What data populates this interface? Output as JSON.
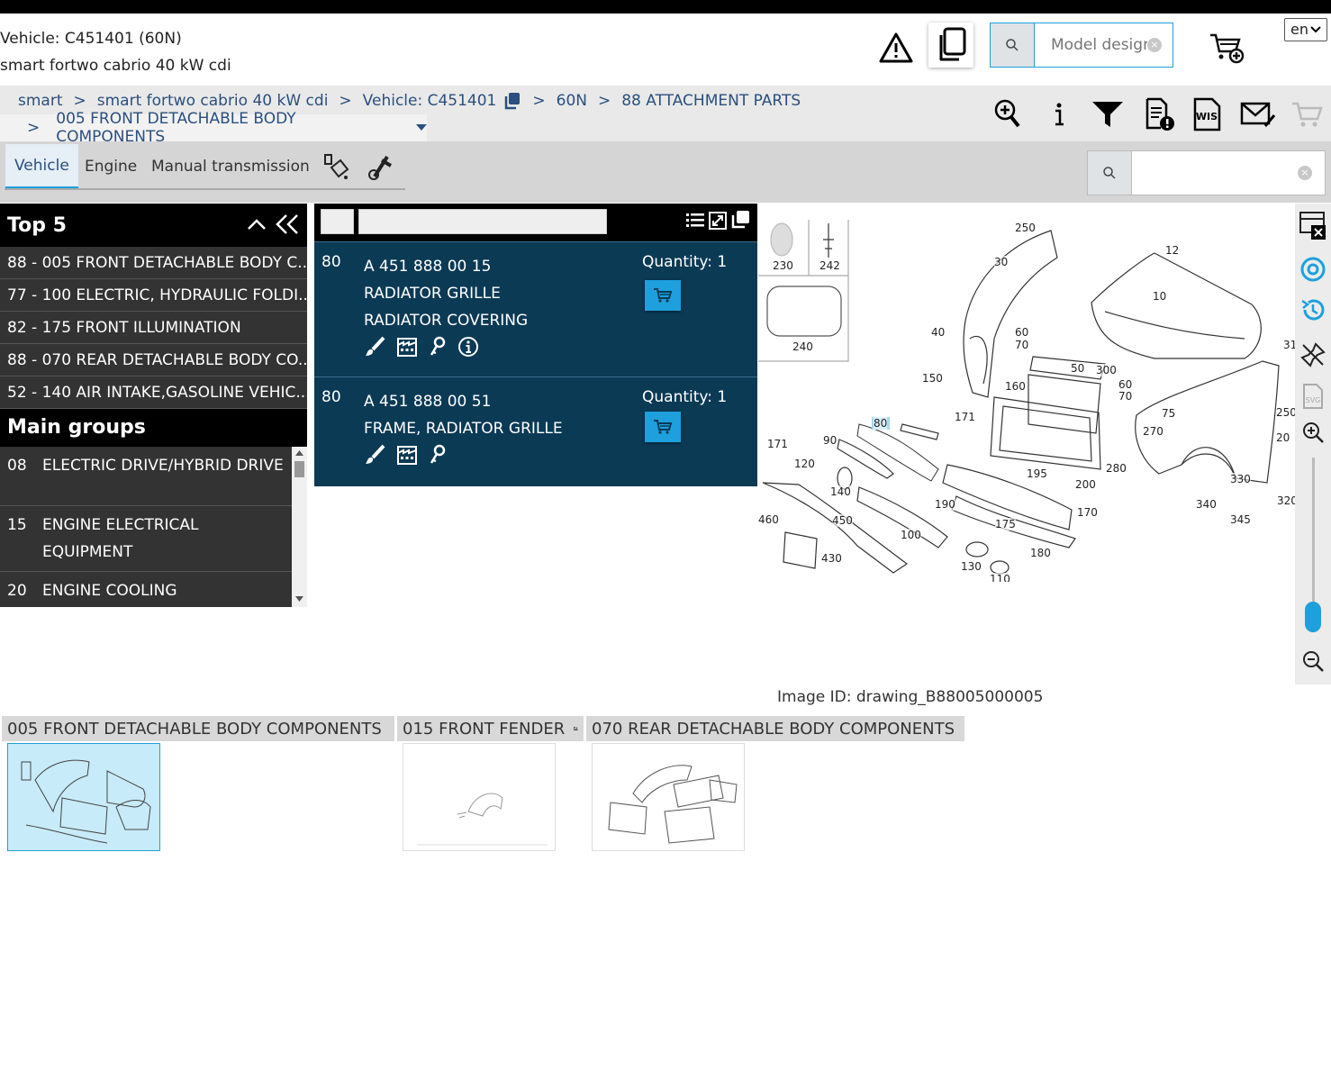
{
  "vehicle": {
    "line1": "Vehicle: C451401 (60N)",
    "line2": "smart fortwo cabrio 40 kW cdi"
  },
  "header_search": {
    "placeholder": "Model design"
  },
  "language": "en",
  "breadcrumb": {
    "items": [
      "smart",
      "smart fortwo cabrio 40 kW cdi",
      "Vehicle: C451401",
      "60N",
      "88 ATTACHMENT PARTS"
    ],
    "sep": ">",
    "current": "005 FRONT DETACHABLE BODY COMPONENTS"
  },
  "tabs": [
    "Vehicle",
    "Engine",
    "Manual transmission"
  ],
  "top5": {
    "title": "Top 5",
    "items": [
      "88 - 005 FRONT DETACHABLE BODY C...",
      "77 - 100 ELECTRIC, HYDRAULIC FOLDI...",
      "82 - 175 FRONT ILLUMINATION",
      "88 - 070 REAR DETACHABLE BODY CO...",
      "52 - 140 AIR INTAKE,GASOLINE VEHIC..."
    ]
  },
  "main_groups": {
    "title": "Main groups",
    "items": [
      {
        "num": "08",
        "label": "ELECTRIC DRIVE/HYBRID DRIVE"
      },
      {
        "num": "15",
        "label": "ENGINE ELECTRICAL EQUIPMENT"
      },
      {
        "num": "20",
        "label": "ENGINE COOLING"
      }
    ]
  },
  "parts": [
    {
      "pos": "80",
      "part_no": "A 451 888 00 15",
      "name": "RADIATOR GRILLE",
      "desc": "RADIATOR COVERING",
      "qty": "Quantity: 1"
    },
    {
      "pos": "80",
      "part_no": "A 451 888 00 51",
      "name": "FRAME, RADIATOR GRILLE",
      "desc": "",
      "qty": "Quantity: 1"
    }
  ],
  "drawing_labels": [
    "250",
    "12",
    "30",
    "10",
    "40",
    "60",
    "70",
    "31",
    "150",
    "160",
    "50",
    "300",
    "60",
    "70",
    "75",
    "250",
    "171",
    "80",
    "270",
    "20",
    "171",
    "90",
    "120",
    "280",
    "195",
    "200",
    "330",
    "140",
    "190",
    "170",
    "340",
    "320",
    "345",
    "460",
    "450",
    "175",
    "100",
    "180",
    "430",
    "130",
    "110",
    "230",
    "242",
    "240"
  ],
  "image_id": "Image ID: drawing_B88005000005",
  "thumbnails": [
    {
      "label": "005 FRONT DETACHABLE BODY COMPONENTS"
    },
    {
      "label": "015 FRONT FENDER"
    },
    {
      "label": "070 REAR DETACHABLE BODY COMPONENTS"
    }
  ],
  "colors": {
    "accent": "#1ea0dc",
    "panel": "#0b3a55",
    "link": "#2b4f7e"
  }
}
